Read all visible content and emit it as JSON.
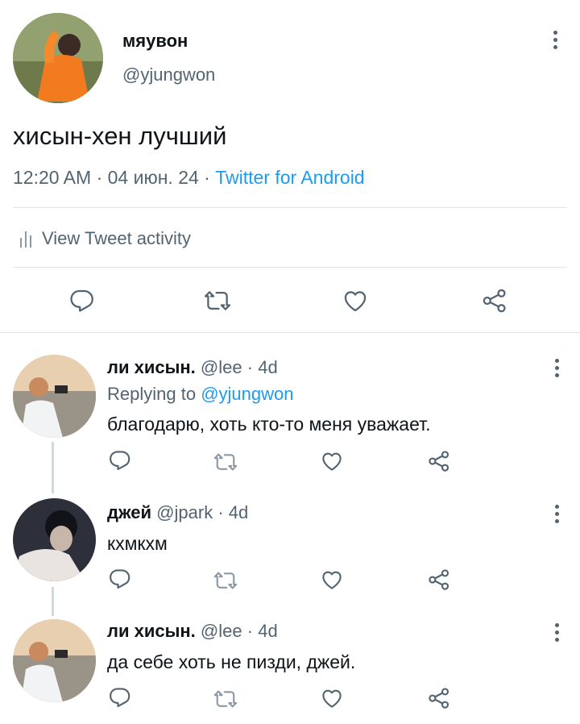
{
  "colors": {
    "text": "#0f1419",
    "muted": "#536471",
    "accent": "#1d9bf0",
    "divider": "#e1e5e8"
  },
  "main_tweet": {
    "display_name": "мяувон",
    "handle": "@yjungwon",
    "text": "хисын-хен лучший",
    "time": "12:20 AM",
    "date": "04 июн. 24",
    "separator": "·",
    "source": "Twitter for Android",
    "activity_label": "View Tweet activity"
  },
  "replies": [
    {
      "display_name": "ли хисын.",
      "handle": "@lee",
      "age": "4d",
      "replying_label": "Replying to",
      "replying_to": "@yjungwon",
      "text": "благодарю, хоть кто-то меня уважает."
    },
    {
      "display_name": "джей",
      "handle": "@jpark",
      "age": "4d",
      "text": "кхмкхм"
    },
    {
      "display_name": "ли хисын.",
      "handle": "@lee",
      "age": "4d",
      "text": "да себе хоть не пизди, джей."
    }
  ],
  "icons": {
    "reply": "reply-icon",
    "retweet": "retweet-icon",
    "like": "heart-icon",
    "share": "share-icon",
    "more": "more-vertical-icon",
    "activity": "bar-chart-icon"
  }
}
